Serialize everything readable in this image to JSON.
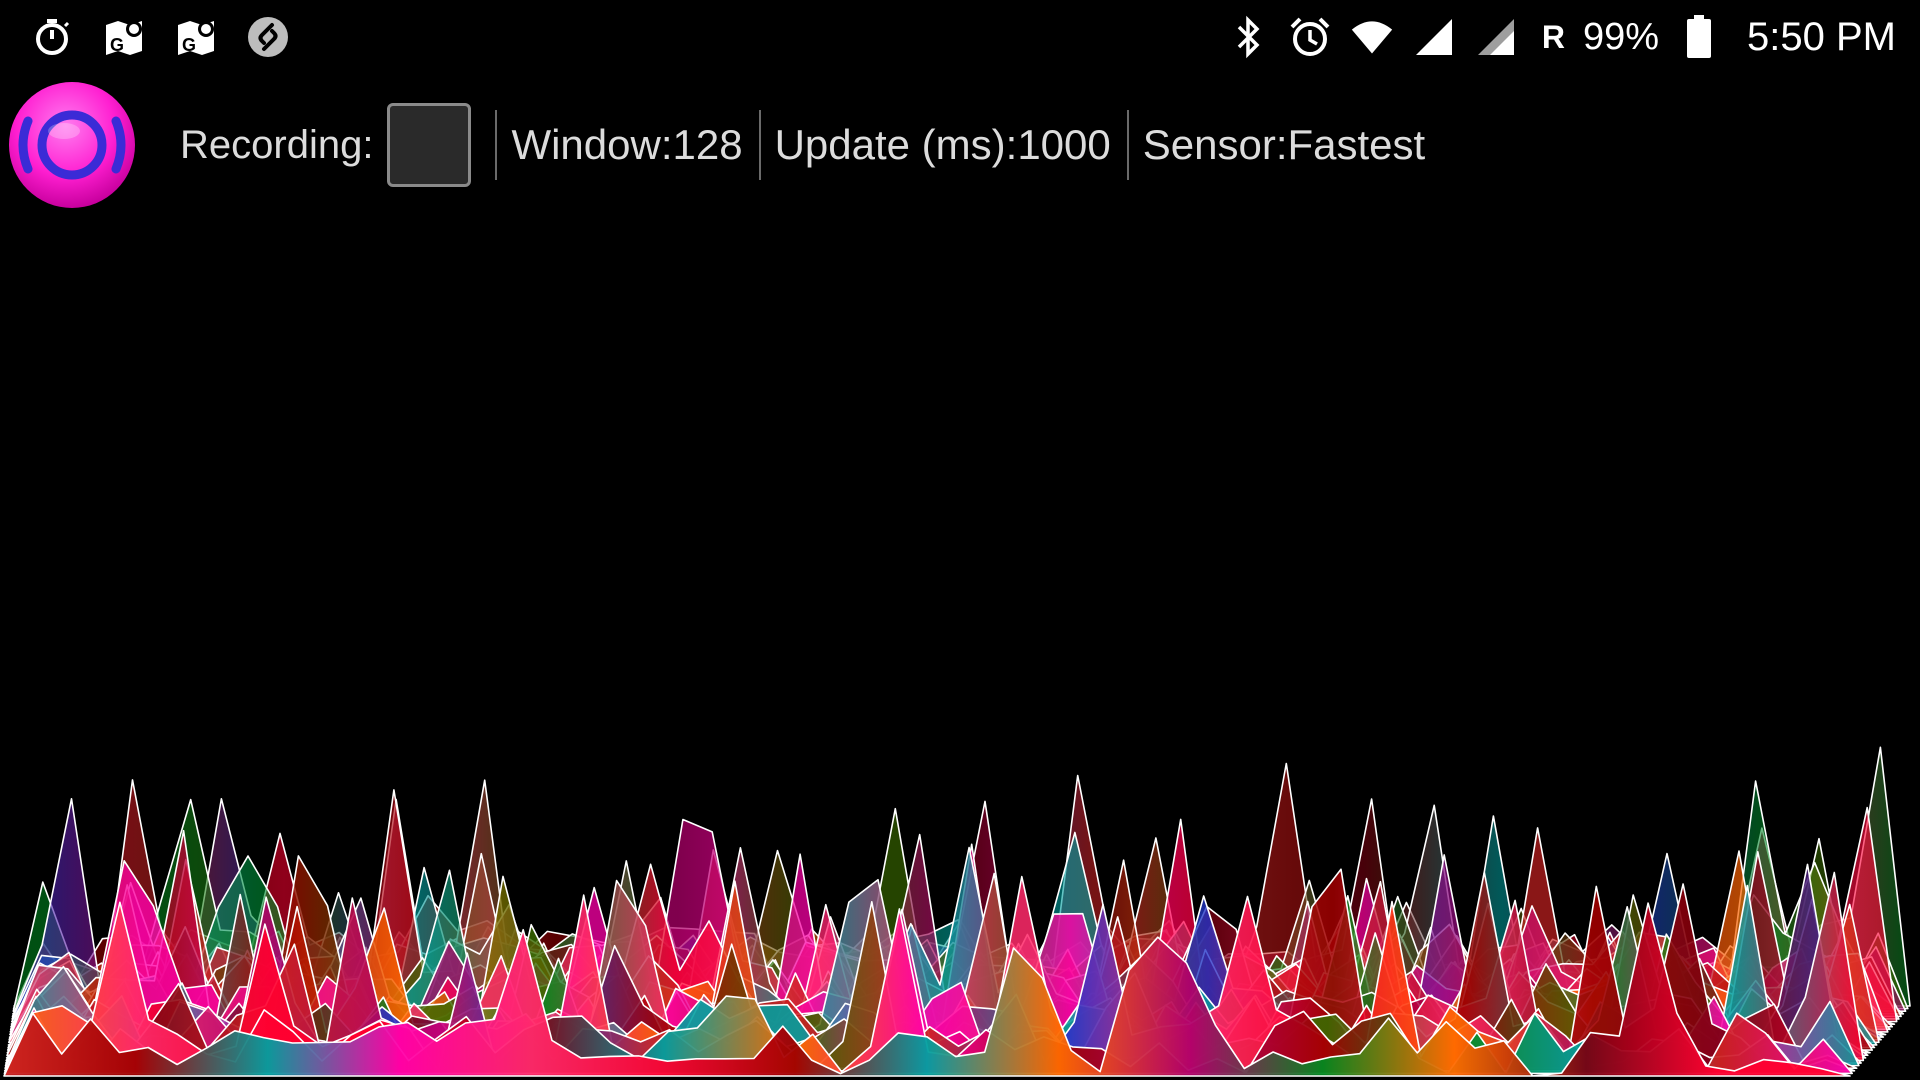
{
  "status_bar": {
    "left_icons": [
      "stopwatch-icon",
      "maps-g-icon",
      "maps-g-icon-2",
      "shazam-icon"
    ],
    "right_icons": [
      "bluetooth-icon",
      "alarm-icon",
      "wifi-icon",
      "signal-icon",
      "signal-icon-2"
    ],
    "carrier": "R",
    "battery": "99%",
    "time": "5:50 PM"
  },
  "toolbar": {
    "recording_label": "Recording:",
    "recording_checked": false,
    "window_label": "Window:",
    "window_value": "128",
    "update_label": "Update (ms):",
    "update_value": "1000",
    "sensor_label": "Sensor:",
    "sensor_value": "Fastest"
  },
  "colors": {
    "background": "#000000",
    "text": "#dcdcdc",
    "app_icon_outer": "#ff1fd1",
    "app_icon_ring": "#3b2bd6",
    "trace_stroke": "#ffffff"
  },
  "visualization": {
    "type": "spectrogram-waterfall",
    "layers": 28,
    "bins": 64
  }
}
